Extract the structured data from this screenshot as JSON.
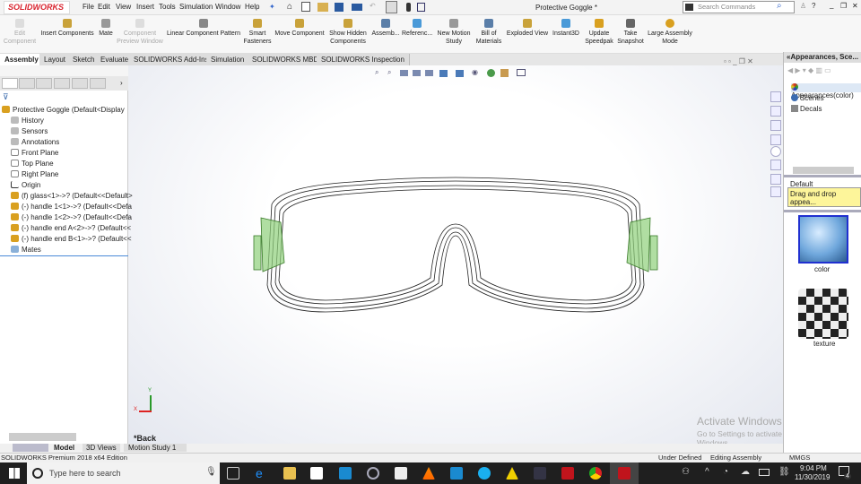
{
  "app": {
    "logo": "SOLIDWORKS",
    "title": "Protective Goggle *",
    "search_placeholder": "Search Commands"
  },
  "menu": [
    "File",
    "Edit",
    "View",
    "Insert",
    "Tools",
    "Simulation",
    "Window",
    "Help"
  ],
  "ribbon": [
    {
      "label": "Edit Component",
      "disabled": true
    },
    {
      "label": "Insert Components",
      "disabled": false
    },
    {
      "label": "Mate",
      "disabled": false
    },
    {
      "label": "Component Preview Window",
      "disabled": true
    },
    {
      "label": "Linear Component Pattern",
      "disabled": false
    },
    {
      "label": "Smart Fasteners",
      "disabled": false
    },
    {
      "label": "Move Component",
      "disabled": false
    },
    {
      "label": "Show Hidden Components",
      "disabled": false
    },
    {
      "label": "Assemb...",
      "disabled": false
    },
    {
      "label": "Referenc...",
      "disabled": false
    },
    {
      "label": "New Motion Study",
      "disabled": false
    },
    {
      "label": "Bill of Materials",
      "disabled": false
    },
    {
      "label": "Exploded View",
      "disabled": false
    },
    {
      "label": "Instant3D",
      "disabled": false
    },
    {
      "label": "Update Speedpak",
      "disabled": false
    },
    {
      "label": "Take Snapshot",
      "disabled": false
    },
    {
      "label": "Large Assembly Mode",
      "disabled": false
    }
  ],
  "tabs": [
    "Assembly",
    "Layout",
    "Sketch",
    "Evaluate",
    "SOLIDWORKS Add-Ins",
    "Simulation",
    "SOLIDWORKS MBD",
    "SOLIDWORKS Inspection"
  ],
  "tree": [
    "Protective Goggle  (Default<Display St",
    "History",
    "Sensors",
    "Annotations",
    "Front Plane",
    "Top Plane",
    "Right Plane",
    "Origin",
    "(f) glass<1>->? (Default<<Default>",
    "(-) handle 1<1>->? (Default<<Defa",
    "(-) handle 1<2>->? (Default<<Defa",
    "(-) handle end A<2>->? (Default<<",
    "(-) handle end B<1>->? (Default<<",
    "Mates"
  ],
  "viewport": {
    "view_label": "*Back",
    "watermark_title": "Activate Windows",
    "watermark_sub": "Go to Settings to activate Windows."
  },
  "bottom_tabs": [
    "Model",
    "3D Views",
    "Motion Study 1"
  ],
  "right_panel": {
    "title": "«Appearances, Sce...",
    "items": [
      "Appearances(color)",
      "Scenes",
      "Decals"
    ],
    "default_label": "Default Appearance:...",
    "hint": "Drag and drop appea...",
    "swatches": [
      "color",
      "texture"
    ]
  },
  "status": {
    "edition": "SOLIDWORKS Premium 2018 x64 Edition",
    "state": "Under Defined",
    "mode": "Editing Assembly",
    "units": "MMGS"
  },
  "taskbar": {
    "search_placeholder": "Type here to search",
    "time": "9:04 PM",
    "date": "11/30/2019",
    "notifications": "4"
  },
  "colors": {
    "accent": "#d9232e",
    "goggle_green": "#5fb04a",
    "selection": "#2030d0"
  }
}
